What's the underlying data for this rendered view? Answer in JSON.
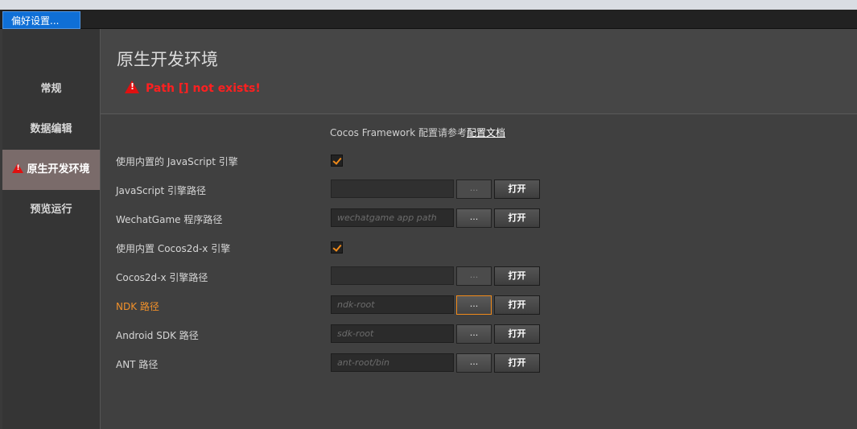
{
  "window": {
    "tab_title": "偏好设置..."
  },
  "sidebar": {
    "items": [
      {
        "label": "常规"
      },
      {
        "label": "数据编辑"
      },
      {
        "label": "原生开发环境"
      },
      {
        "label": "预览运行"
      }
    ]
  },
  "header": {
    "title": "原生开发环境",
    "error": "Path [] not exists!"
  },
  "note": {
    "text": "Cocos Framework 配置请参考",
    "link": "配置文档"
  },
  "rows": [
    {
      "label": "使用内置的 JavaScript 引擎"
    },
    {
      "label": "JavaScript 引擎路径"
    },
    {
      "label": "WechatGame 程序路径",
      "placeholder": "wechatgame app path"
    },
    {
      "label": "使用内置 Cocos2d-x 引擎"
    },
    {
      "label": "Cocos2d-x 引擎路径"
    },
    {
      "label": "NDK 路径",
      "placeholder": "ndk-root"
    },
    {
      "label": "Android SDK 路径",
      "placeholder": "sdk-root"
    },
    {
      "label": "ANT 路径",
      "placeholder": "ant-root/bin"
    }
  ],
  "buttons": {
    "browse": "...",
    "open": "打开"
  }
}
